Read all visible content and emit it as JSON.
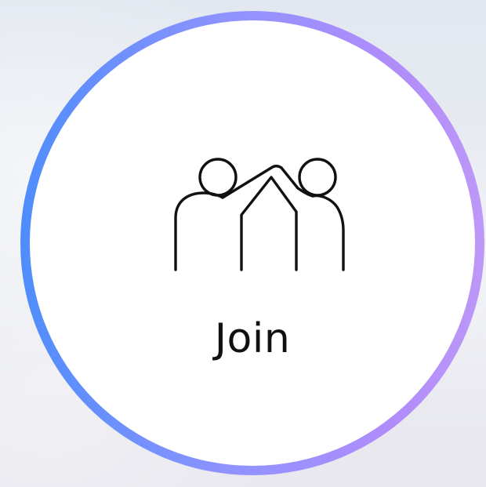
{
  "join_button": {
    "label": "Join",
    "icon": "high-five-people-icon",
    "ring_gradient": [
      "#4f8dfc",
      "#8f93ff",
      "#b08cfb",
      "#bd98f8"
    ],
    "fill_color": "#ffffff",
    "text_color": "#111111"
  }
}
